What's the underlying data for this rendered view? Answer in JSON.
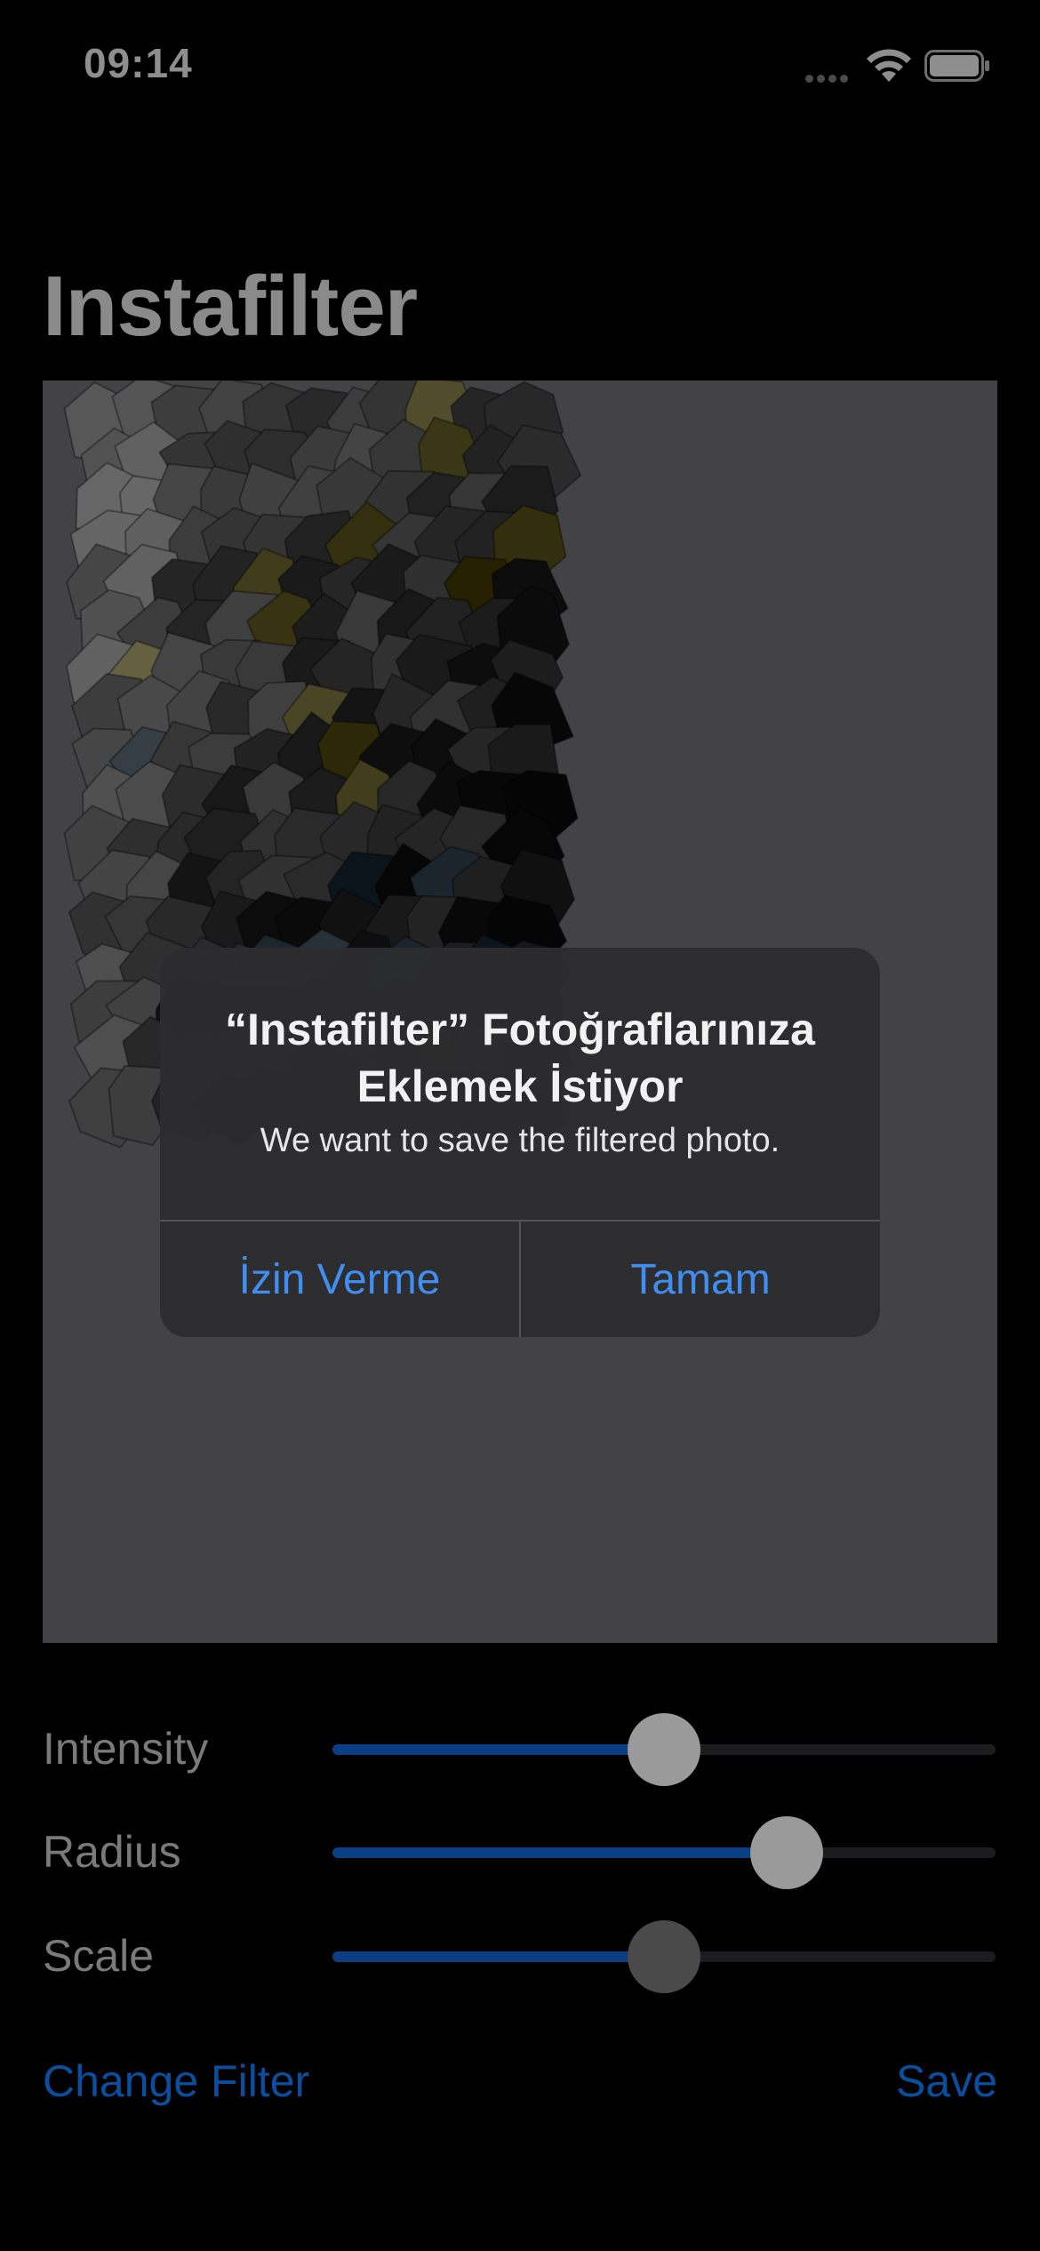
{
  "status_bar": {
    "time": "09:14",
    "signal_icon": "signal-dots-icon",
    "wifi_icon": "wifi-icon",
    "battery_icon": "battery-full-icon"
  },
  "nav": {
    "title": "Instafilter"
  },
  "image": {
    "description_icon": "crystallize-filtered-photo"
  },
  "controls": {
    "intensity": {
      "label": "Intensity",
      "value": 0.5
    },
    "radius": {
      "label": "Radius",
      "value": 0.685
    },
    "scale": {
      "label": "Scale",
      "value": 0.5
    }
  },
  "bottom_bar": {
    "change_filter_label": "Change Filter",
    "save_label": "Save"
  },
  "alert": {
    "title": "“Instafilter” Fotoğraflarınıza Eklemek İstiyor",
    "message": "We want to save the filtered photo.",
    "deny_label": "İzin Verme",
    "ok_label": "Tamam"
  },
  "colors": {
    "background": "#000000",
    "accent_blue": "#3f8ef0",
    "dimmed_blue": "#0a4ea0",
    "slider_fill": "#0b3f84"
  }
}
